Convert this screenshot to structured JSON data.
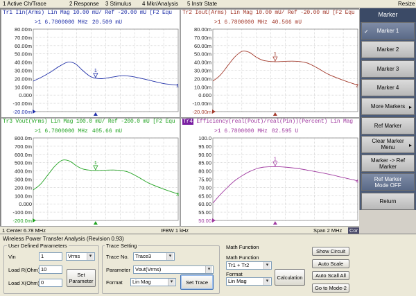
{
  "menubar": {
    "items": [
      "1 Active Ch/Trace",
      "2 Response",
      "3 Stimulus",
      "4 Mkr/Analysis",
      "5 Instr State"
    ],
    "resize": "Resize"
  },
  "plots": [
    {
      "header": "Tr1 Iin(Arms) Lin Mag 10.00 mU/ Ref -20.00 mU [F2 Equ",
      "marker_line": ">1  6.7800000 MHz",
      "marker_value": "20.509 mU",
      "color": "#1f2fa8",
      "ylabels": [
        "80.00m",
        "70.00m",
        "60.00m",
        "50.00m",
        "40.00m",
        "30.00m",
        "20.00m",
        "10.00m",
        "0.000",
        "-10.00m",
        "-20.00m"
      ],
      "ref_label": "-20.00m",
      "trace_end_label": "1",
      "marker_label": "1",
      "y_min": -20,
      "y_max": 80,
      "points": [
        [
          0,
          17
        ],
        [
          0.06,
          22
        ],
        [
          0.12,
          28
        ],
        [
          0.18,
          35
        ],
        [
          0.24,
          40
        ],
        [
          0.29,
          38
        ],
        [
          0.34,
          30
        ],
        [
          0.39,
          23
        ],
        [
          0.43,
          20.5
        ],
        [
          0.48,
          20
        ],
        [
          0.55,
          22
        ],
        [
          0.62,
          23.5
        ],
        [
          0.7,
          22
        ],
        [
          0.8,
          18
        ],
        [
          0.9,
          14
        ],
        [
          1,
          12
        ]
      ],
      "marker_x": 0.43
    },
    {
      "header": "Tr2 Iout(Arms) Lin Mag 10.00 mU/ Ref -20.00 mU [F2 Equ",
      "marker_line": ">1  6.7800000 MHz",
      "marker_value": "40.566 mU",
      "color": "#a33a2c",
      "ylabels": [
        "80.00m",
        "70.00m",
        "60.00m",
        "50.00m",
        "40.00m",
        "30.00m",
        "20.00m",
        "10.00m",
        "0.000",
        "-10.00m",
        "-20.00m"
      ],
      "ref_label": "-20.00m",
      "trace_end_label": "2",
      "marker_label": "1",
      "y_min": -20,
      "y_max": 80,
      "points": [
        [
          0,
          17
        ],
        [
          0.05,
          24
        ],
        [
          0.1,
          35
        ],
        [
          0.15,
          46
        ],
        [
          0.2,
          53
        ],
        [
          0.25,
          52
        ],
        [
          0.3,
          46
        ],
        [
          0.35,
          42
        ],
        [
          0.43,
          40.5
        ],
        [
          0.5,
          41
        ],
        [
          0.58,
          41
        ],
        [
          0.65,
          39
        ],
        [
          0.72,
          33
        ],
        [
          0.8,
          25
        ],
        [
          0.9,
          18
        ],
        [
          1,
          12
        ]
      ],
      "marker_x": 0.43
    },
    {
      "header": "Tr3 Vout(Vrms) Lin Mag 100.0 mU/ Ref -200.0 mU [F2 Equ",
      "marker_line": ">1  6.7800000 MHz",
      "marker_value": "405.66 mU",
      "color": "#21a321",
      "ylabels": [
        "800.0m",
        "700.0m",
        "600.0m",
        "500.0m",
        "400.0m",
        "300.0m",
        "200.0m",
        "100.0m",
        "0.000",
        "-100.0m",
        "-200.0m"
      ],
      "ref_label": "-200.0m",
      "trace_end_label": "3",
      "marker_label": "1",
      "y_min": -200,
      "y_max": 800,
      "points": [
        [
          0,
          170
        ],
        [
          0.05,
          240
        ],
        [
          0.1,
          350
        ],
        [
          0.15,
          460
        ],
        [
          0.2,
          530
        ],
        [
          0.25,
          520
        ],
        [
          0.3,
          460
        ],
        [
          0.35,
          420
        ],
        [
          0.43,
          405.7
        ],
        [
          0.5,
          410
        ],
        [
          0.58,
          410
        ],
        [
          0.65,
          390
        ],
        [
          0.72,
          330
        ],
        [
          0.8,
          250
        ],
        [
          0.9,
          180
        ],
        [
          1,
          120
        ]
      ],
      "marker_x": 0.43
    },
    {
      "header_tag": "Tr4",
      "header": " Efficiency(real(Pout)/real(Pin))(Percent) Lin Mag",
      "marker_line": ">1  6.7800000 MHz",
      "marker_value": "82.595 U",
      "color": "#a03aa0",
      "ylabels": [
        "100.0",
        "95.00",
        "90.00",
        "85.00",
        "80.00",
        "75.00",
        "70.00",
        "65.00",
        "60.00",
        "55.00",
        "50.00"
      ],
      "ref_label": "50.00",
      "trace_end_label": "4",
      "marker_label": "1",
      "y_min": 50,
      "y_max": 100,
      "points": [
        [
          0,
          60.5
        ],
        [
          0.05,
          65.5
        ],
        [
          0.1,
          70
        ],
        [
          0.15,
          74
        ],
        [
          0.2,
          77
        ],
        [
          0.25,
          79.5
        ],
        [
          0.3,
          81.3
        ],
        [
          0.35,
          82.3
        ],
        [
          0.43,
          82.6
        ],
        [
          0.5,
          82.3
        ],
        [
          0.6,
          81.3
        ],
        [
          0.7,
          79.7
        ],
        [
          0.8,
          78
        ],
        [
          0.9,
          76
        ],
        [
          1,
          74
        ]
      ],
      "marker_x": 0.43
    }
  ],
  "statusbar": {
    "left": "1  Center  6.78 MHz",
    "middle": "IFBW 1 kHz",
    "right": "Span 2 MHz",
    "cor": "Cor"
  },
  "softkeys": {
    "title": "Marker",
    "items": [
      {
        "label": "Marker 1",
        "selected": true,
        "check": "✓"
      },
      {
        "label": "Marker 2"
      },
      {
        "label": "Marker 3"
      },
      {
        "label": "Marker 4"
      },
      {
        "label": "More Markers",
        "arrow": "▸"
      },
      {
        "label": "Ref Marker"
      },
      {
        "label": "Clear Marker Menu",
        "arrow": "▸"
      },
      {
        "label": "Marker -> Ref Marker"
      },
      {
        "label": "Ref Marker Mode OFF",
        "selected": true
      },
      {
        "label": "Return"
      }
    ]
  },
  "panel": {
    "title": "Wireless Power Transfer Analysis  (Revision 0.93)",
    "user_params": {
      "title": "User Defined Parameters",
      "vin_label": "Vin",
      "vin_value": "1",
      "vin_unit": "Vrms",
      "load_r_label": "Load R(Ohm)",
      "load_r_value": "10",
      "load_x_label": "Load X(Ohm)",
      "load_x_value": "0",
      "set_parameter": "Set Parameter"
    },
    "trace_setting": {
      "title": "Trace Setting",
      "trace_no_label": "Trace No.",
      "trace_no_value": "Trace3",
      "parameter_label": "Parameter",
      "parameter_value": "Vout(Vrms)",
      "format_label": "Format",
      "format_value": "Lin Mag",
      "set_trace": "Set Trace"
    },
    "math": {
      "title": "Math Function",
      "function_label": "Math Function",
      "function_value": "Tr1 + Tr2",
      "format_label": "Format",
      "format_value": "Lin Mag",
      "calculation": "Calculation"
    },
    "buttons": {
      "show_circuit": "Show Circuit",
      "auto_scale": "Auto Scale",
      "auto_scale_all": "Auto Scall All",
      "go_to_mode2": "Go to Mode-2"
    }
  }
}
